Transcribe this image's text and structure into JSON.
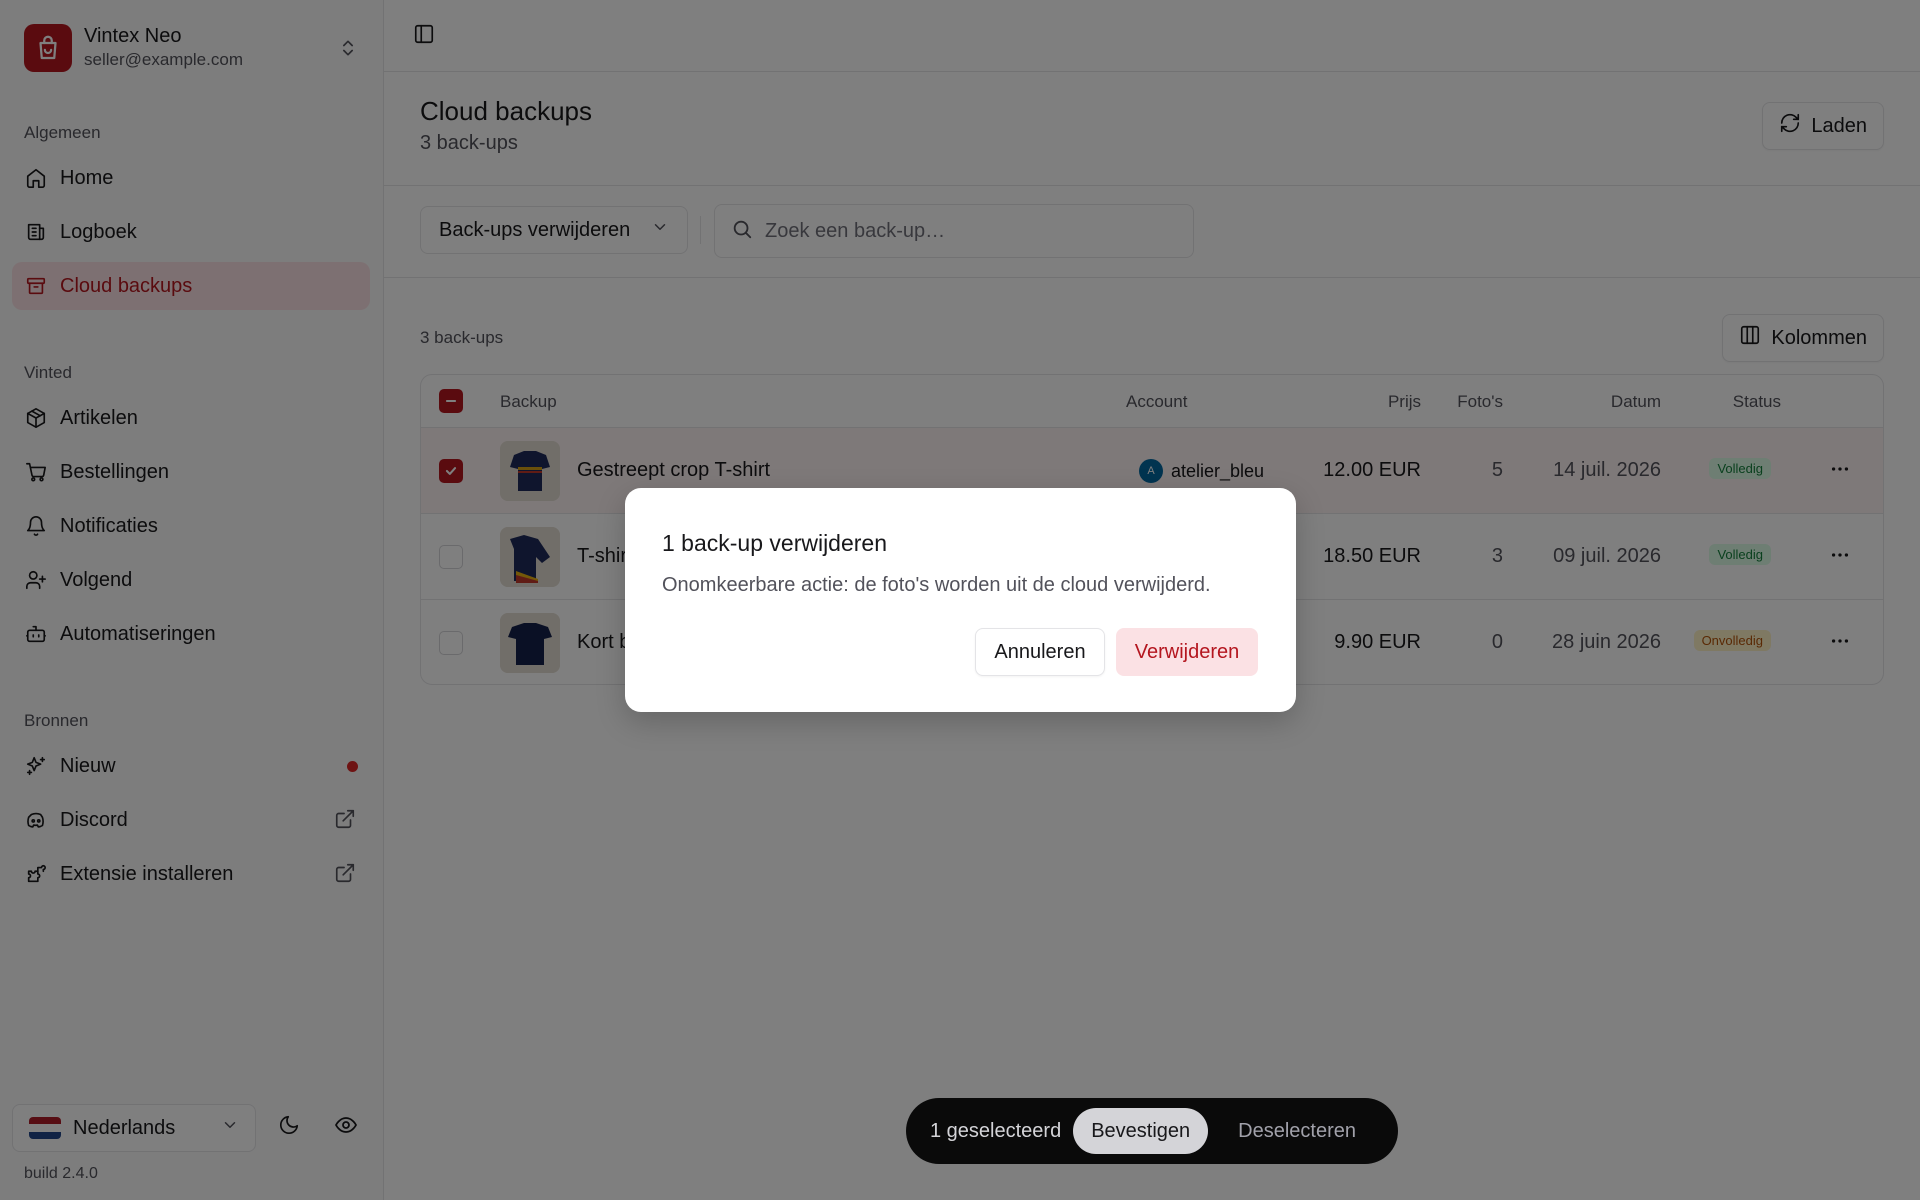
{
  "brand": {
    "name": "Vintex Neo",
    "email": "seller@example.com",
    "color": "#b4161f"
  },
  "sidebar": {
    "groups": [
      {
        "label": "Algemeen"
      },
      {
        "label": "Vinted"
      },
      {
        "label": "Bronnen"
      }
    ],
    "items": [
      {
        "label": "Home",
        "icon": "home-icon"
      },
      {
        "label": "Logboek",
        "icon": "logbook-icon"
      },
      {
        "label": "Cloud backups",
        "icon": "archive-icon",
        "active": true
      },
      {
        "label": "Artikelen",
        "icon": "package-icon"
      },
      {
        "label": "Bestellingen",
        "icon": "cart-icon"
      },
      {
        "label": "Notificaties",
        "icon": "bell-icon"
      },
      {
        "label": "Volgend",
        "icon": "user-plus-icon"
      },
      {
        "label": "Automatiseringen",
        "icon": "bot-icon"
      },
      {
        "label": "Nieuw",
        "icon": "sparkles-icon",
        "badge": "dot"
      },
      {
        "label": "Discord",
        "icon": "discord-icon",
        "external": true
      },
      {
        "label": "Extensie installeren",
        "icon": "puzzle-icon",
        "external": true
      }
    ],
    "language": "Nederlands",
    "build": "build 2.4.0"
  },
  "page": {
    "title": "Cloud backups",
    "subtitle": "3 back-ups",
    "reload_label": "Laden"
  },
  "toolbar": {
    "action_select": "Back-ups verwijderen",
    "search_placeholder": "Zoek een back-up…"
  },
  "table": {
    "count_label": "3 back-ups",
    "columns_label": "Kolommen",
    "headers": {
      "backup": "Backup",
      "account": "Account",
      "price": "Prijs",
      "photos": "Foto's",
      "date": "Datum",
      "status": "Status"
    },
    "rows": [
      {
        "name": "Gestreept crop T-shirt",
        "account": "atelier_bleu",
        "avatar": "A",
        "price": "12.00 EUR",
        "photos": "5",
        "date": "14 juil. 2026",
        "status": "Volledig",
        "selected": true
      },
      {
        "name": "T-shirt",
        "account": "",
        "avatar": "",
        "price": "18.50 EUR",
        "photos": "3",
        "date": "09 juil. 2026",
        "status": "Volledig",
        "selected": false
      },
      {
        "name": "Kort blauw T-shirt",
        "account": "",
        "avatar": "",
        "price": "9.90 EUR",
        "photos": "0",
        "date": "28 juin 2026",
        "status": "Onvolledig",
        "selected": false
      }
    ]
  },
  "dialog": {
    "title": "1 back-up verwijderen",
    "description": "Onomkeerbare actie: de foto's worden uit de cloud verwijderd.",
    "cancel": "Annuleren",
    "confirm": "Verwijderen"
  },
  "action_bar": {
    "selected": "1 geselecteerd",
    "confirm": "Bevestigen",
    "deselect": "Deselecteren"
  }
}
